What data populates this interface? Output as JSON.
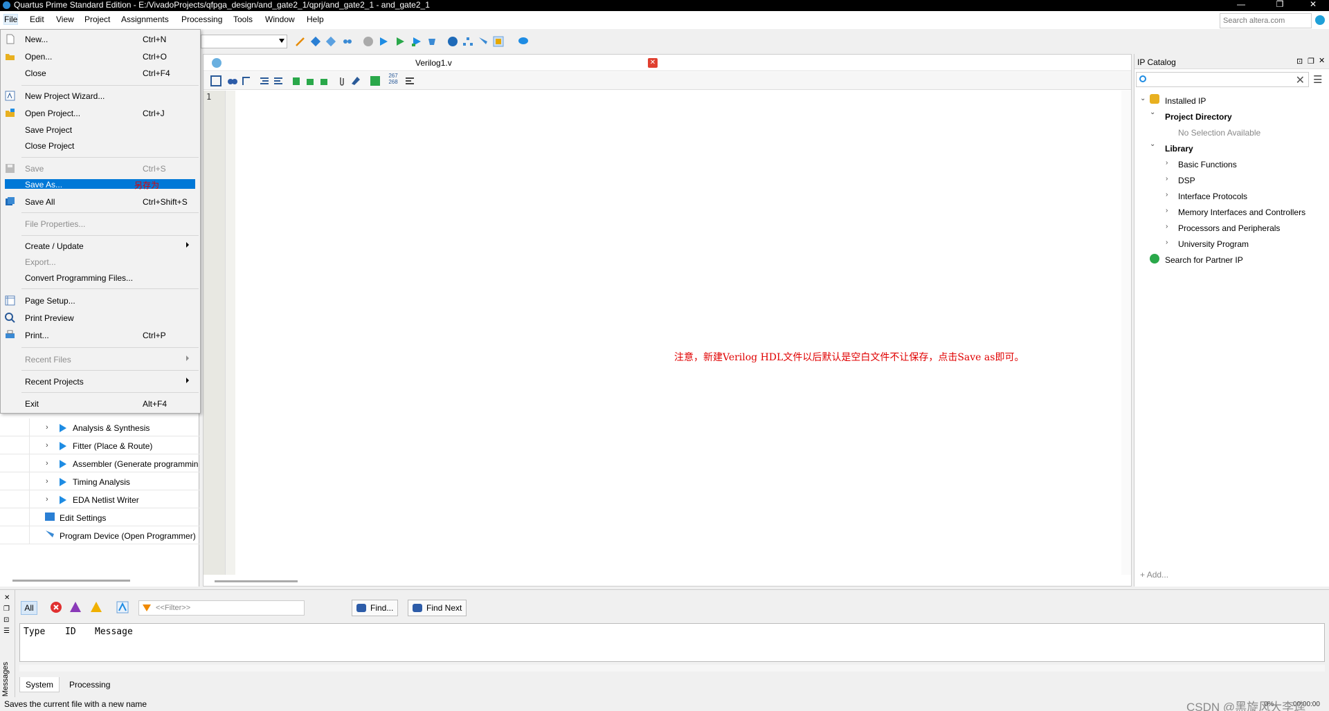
{
  "titlebar": {
    "title": "Quartus Prime Standard Edition - E:/VivadoProjects/qfpga_design/and_gate2_1/qprj/and_gate2_1 - and_gate2_1"
  },
  "menubar": {
    "items": [
      "File",
      "Edit",
      "View",
      "Project",
      "Assignments",
      "Processing",
      "Tools",
      "Window",
      "Help"
    ],
    "search_placeholder": "Search altera.com"
  },
  "file_menu": {
    "new": {
      "label": "New...",
      "shortcut": "Ctrl+N"
    },
    "open": {
      "label": "Open...",
      "shortcut": "Ctrl+O"
    },
    "close": {
      "label": "Close",
      "shortcut": "Ctrl+F4"
    },
    "new_project_wizard": {
      "label": "New Project Wizard..."
    },
    "open_project": {
      "label": "Open Project...",
      "shortcut": "Ctrl+J"
    },
    "save_project": {
      "label": "Save Project"
    },
    "close_project": {
      "label": "Close Project"
    },
    "save": {
      "label": "Save",
      "shortcut": "Ctrl+S"
    },
    "save_as": {
      "label": "Save As...",
      "note": "另存为"
    },
    "save_all": {
      "label": "Save All",
      "shortcut": "Ctrl+Shift+S"
    },
    "file_properties": {
      "label": "File Properties..."
    },
    "create_update": {
      "label": "Create / Update"
    },
    "export": {
      "label": "Export..."
    },
    "convert_programming": {
      "label": "Convert Programming Files..."
    },
    "page_setup": {
      "label": "Page Setup..."
    },
    "print_preview": {
      "label": "Print Preview"
    },
    "print": {
      "label": "Print...",
      "shortcut": "Ctrl+P"
    },
    "recent_files": {
      "label": "Recent Files"
    },
    "recent_projects": {
      "label": "Recent Projects"
    },
    "exit": {
      "label": "Exit",
      "shortcut": "Alt+F4"
    }
  },
  "tasks": [
    "Analysis & Synthesis",
    "Fitter (Place & Route)",
    "Assembler (Generate programmin",
    "Timing Analysis",
    "EDA Netlist Writer",
    "Edit Settings",
    "Program Device (Open Programmer)"
  ],
  "editor": {
    "tab_name": "Verilog1.v",
    "line_number": "1",
    "annotation": "注意，新建Verilog HDL文件以后默认是空白文件不让保存，点击Save as即可。",
    "toolbar_counter_top": "267",
    "toolbar_counter_bottom": "268"
  },
  "ip_catalog": {
    "title": "IP Catalog",
    "installed_ip": "Installed IP",
    "project_directory": "Project Directory",
    "no_selection": "No Selection Available",
    "library": "Library",
    "library_items": [
      "Basic Functions",
      "DSP",
      "Interface Protocols",
      "Memory Interfaces and Controllers",
      "Processors and Peripherals",
      "University Program"
    ],
    "search_partner": "Search for Partner IP",
    "add_label": "Add..."
  },
  "messages": {
    "all_label": "All",
    "filter_placeholder": "<<Filter>>",
    "find_label": "Find...",
    "find_next_label": "Find Next",
    "columns": [
      "Type",
      "ID",
      "Message"
    ],
    "tabs": [
      "System",
      "Processing"
    ],
    "side_label": "Messages"
  },
  "status": {
    "text": "Saves the current file with a new name",
    "percent": "0%",
    "time": "00:00:00"
  },
  "watermark": "CSDN @黑旋风大李逵",
  "colors": {
    "accent": "#0078d7",
    "annotation": "#e00000",
    "play": "#1e8ce3"
  }
}
